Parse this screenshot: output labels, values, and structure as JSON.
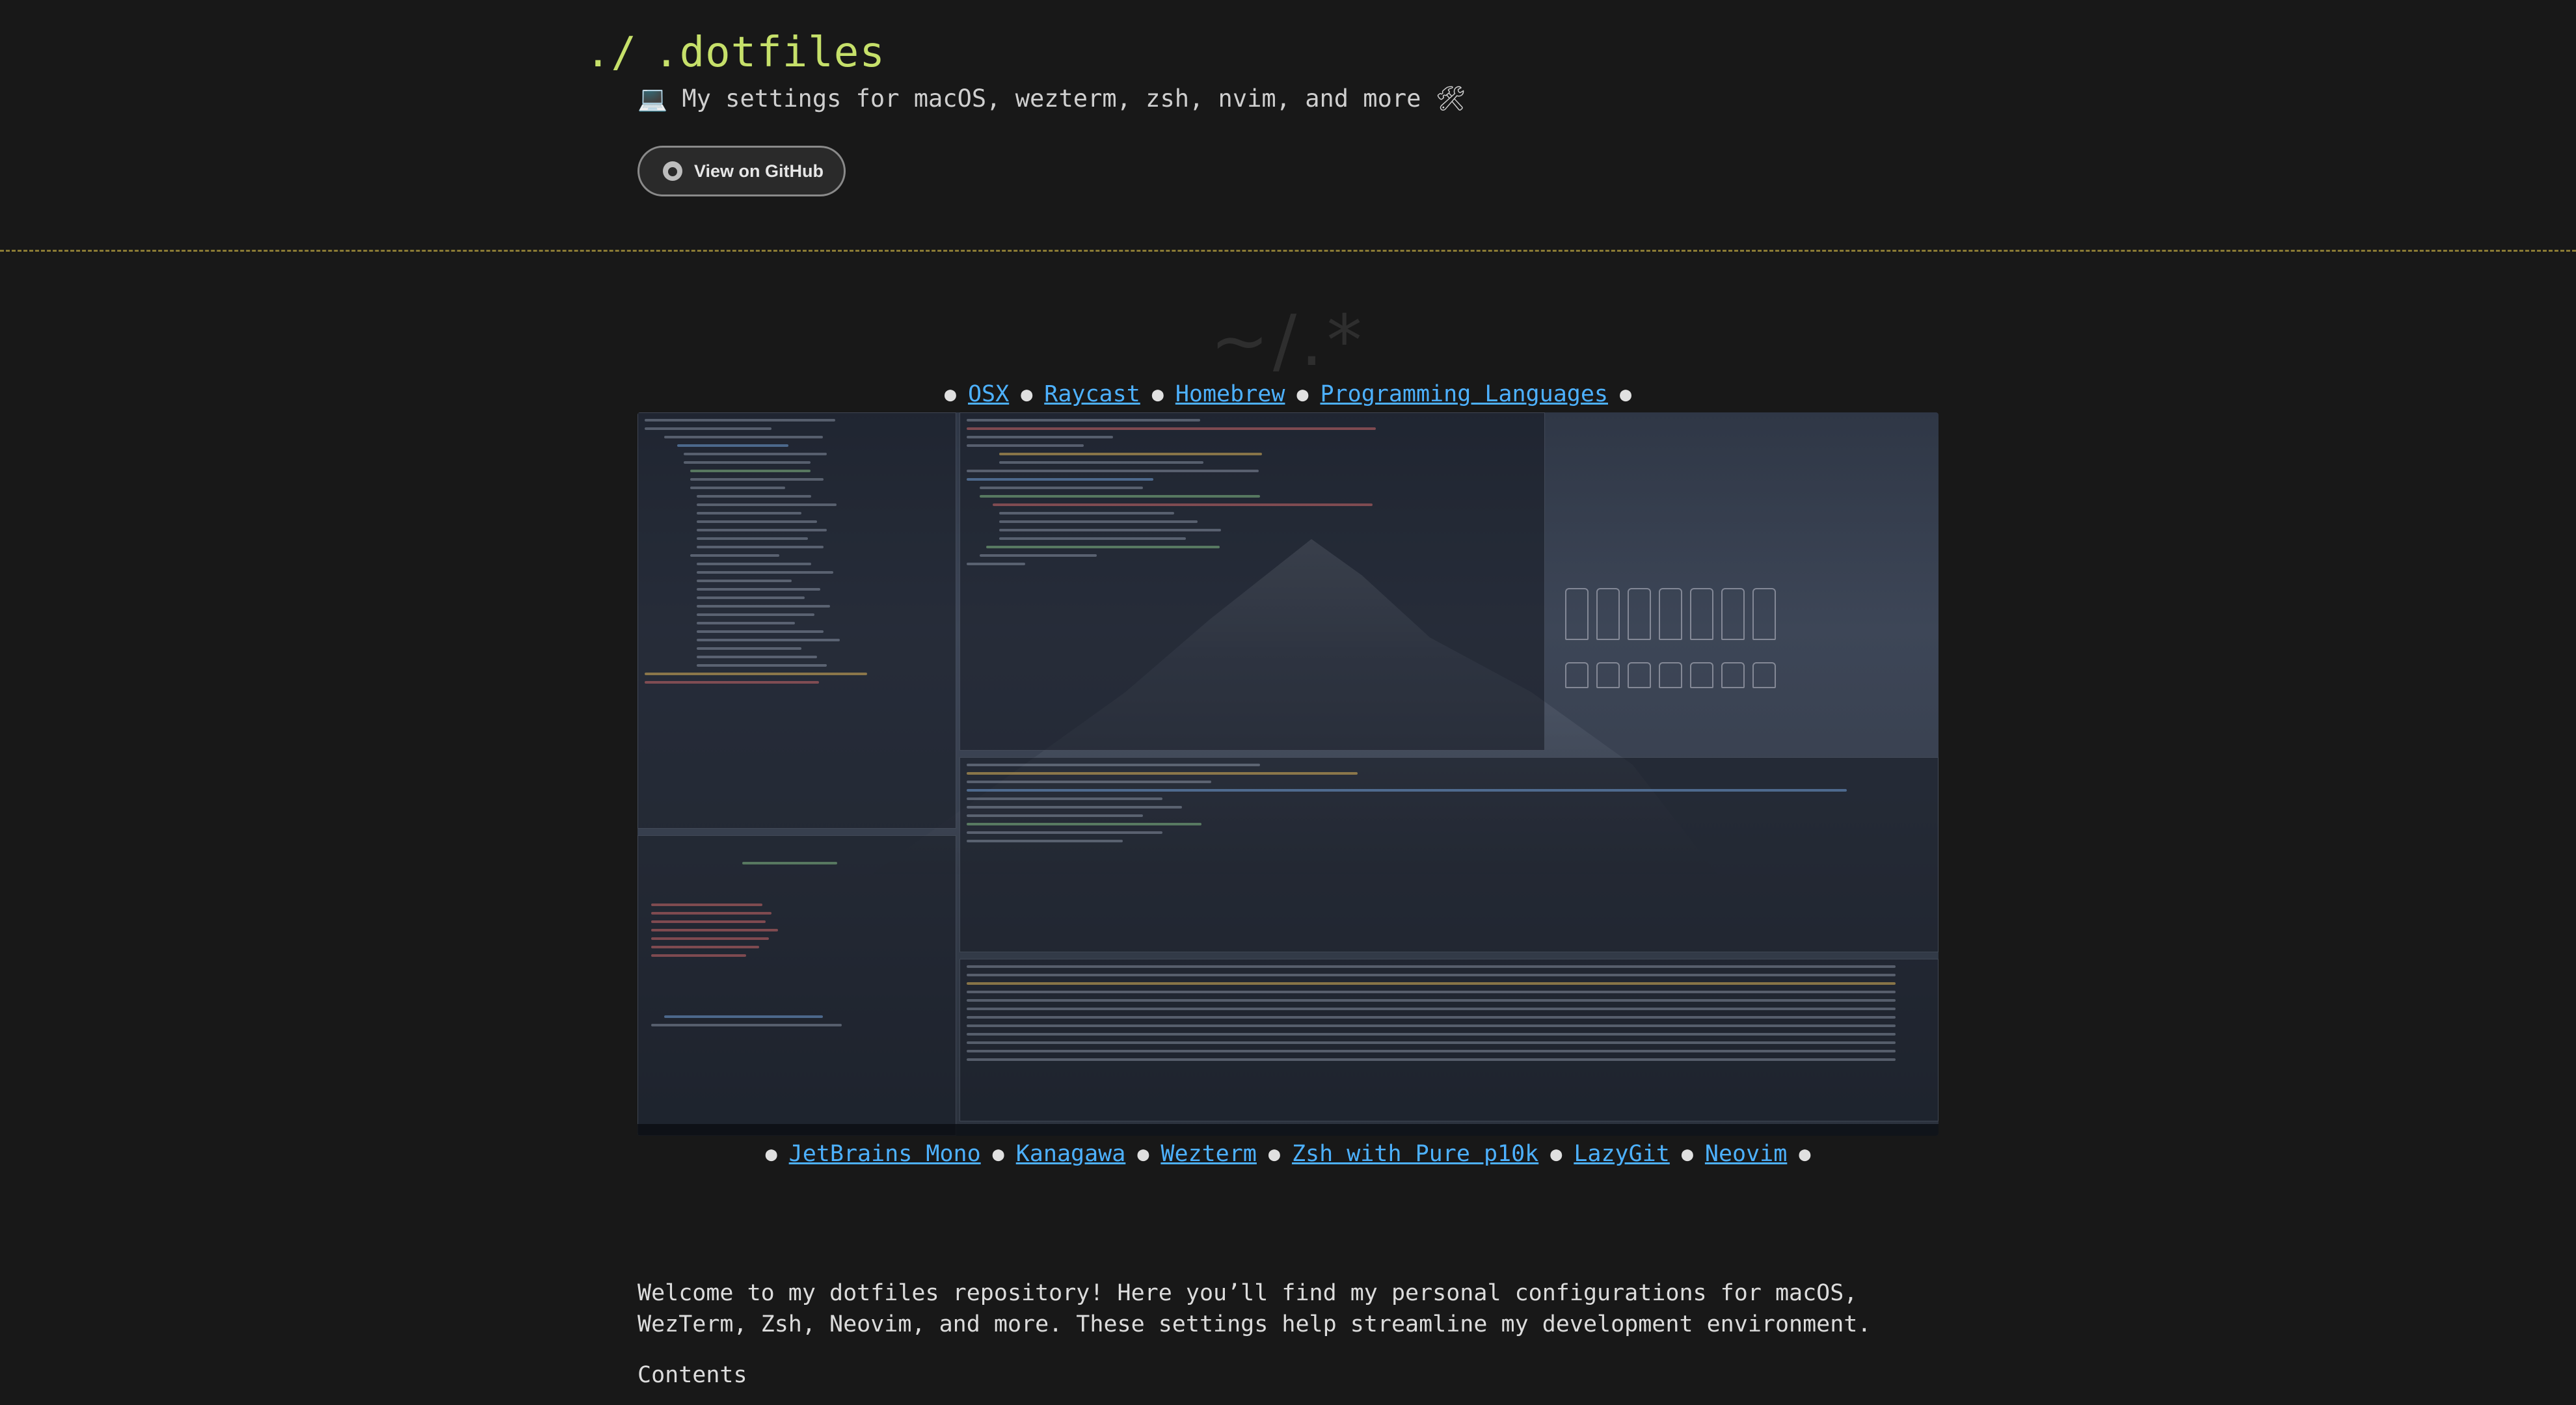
{
  "header": {
    "prompt": "./",
    "title": ".dotfiles",
    "tagline": "💻 My settings for macOS, wezterm, zsh, nvim, and more 🛠",
    "github_button_label": "View on GitHub"
  },
  "hero": {
    "symbol": "~/.*"
  },
  "top_links": [
    {
      "label": "OSX"
    },
    {
      "label": "Raycast"
    },
    {
      "label": "Homebrew"
    },
    {
      "label": "Programming Languages"
    }
  ],
  "screenshot": {
    "description_icon": "terminal-screenshot"
  },
  "bottom_links": [
    {
      "label": "JetBrains Mono"
    },
    {
      "label": "Kanagawa"
    },
    {
      "label": "Wezterm"
    },
    {
      "label": "Zsh with Pure p10k"
    },
    {
      "label": "LazyGit"
    },
    {
      "label": "Neovim"
    }
  ],
  "content": {
    "intro": "Welcome to my dotfiles repository! Here you’ll find my personal configurations for macOS, WezTerm, Zsh, Neovim, and more. These settings help streamline my development environment.",
    "contents_heading": "Contents"
  },
  "colors": {
    "background": "#181818",
    "title": "#c6e06a",
    "link": "#4db1ff",
    "divider": "#8a7a34"
  }
}
